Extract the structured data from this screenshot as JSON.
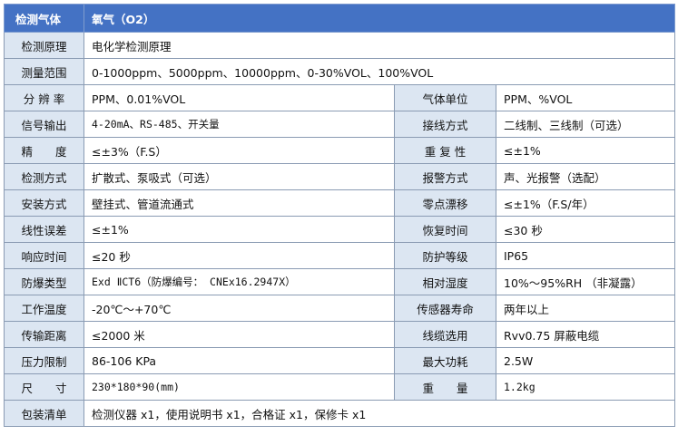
{
  "header": {
    "label": "检测气体",
    "value": "氧气（O2）"
  },
  "rows": [
    {
      "l1": "检测原理",
      "v1": "电化学检测原理"
    },
    {
      "l1": "测量范围",
      "v1": "0-1000ppm、5000ppm、10000ppm、0-30%VOL、100%VOL"
    },
    {
      "l1": "分 辨 率",
      "v1": "PPM、0.01%VOL",
      "l2": "气体单位",
      "v2": "PPM、%VOL"
    },
    {
      "l1": "信号输出",
      "v1": "4-20mA、RS-485、开关量",
      "l2": "接线方式",
      "v2": "二线制、三线制（可选）"
    },
    {
      "l1": "精　　度",
      "v1": "≤±3%（F.S）",
      "l2": "重 复 性",
      "v2": "≤±1%"
    },
    {
      "l1": "检测方式",
      "v1": "扩散式、泵吸式（可选）",
      "l2": "报警方式",
      "v2": "声、光报警（选配）"
    },
    {
      "l1": "安装方式",
      "v1": "壁挂式、管道流通式",
      "l2": "零点漂移",
      "v2": "≤±1%（F.S/年）"
    },
    {
      "l1": "线性误差",
      "v1": "≤±1%",
      "l2": "恢复时间",
      "v2": "≤30 秒"
    },
    {
      "l1": "响应时间",
      "v1": "≤20 秒",
      "l2": "防护等级",
      "v2": "IP65"
    },
    {
      "l1": "防爆类型",
      "v1": "Exd ⅡCT6（防爆编号： CNEx16.2947X）",
      "l2": "相对湿度",
      "v2": "10%～95%RH （非凝露）"
    },
    {
      "l1": "工作温度",
      "v1": "-20℃～+70℃",
      "l2": "传感器寿命",
      "v2": "两年以上"
    },
    {
      "l1": "传输距离",
      "v1": "≤2000 米",
      "l2": "线缆选用",
      "v2": "Rvv0.75 屏蔽电缆"
    },
    {
      "l1": "压力限制",
      "v1": "86-106 KPa",
      "l2": "最大功耗",
      "v2": "2.5W"
    },
    {
      "l1": "尺　　寸",
      "v1": "230*180*90(mm)",
      "l2": "重　　量",
      "v2": "1.2kg"
    },
    {
      "l1": "包装清单",
      "v1": "检测仪器 x1，使用说明书 x1，合格证 x1，保修卡 x1"
    }
  ],
  "colors": {
    "header_bg": "#4472c4",
    "label_bg": "#dce6f2",
    "border": "#8a9bb3"
  }
}
